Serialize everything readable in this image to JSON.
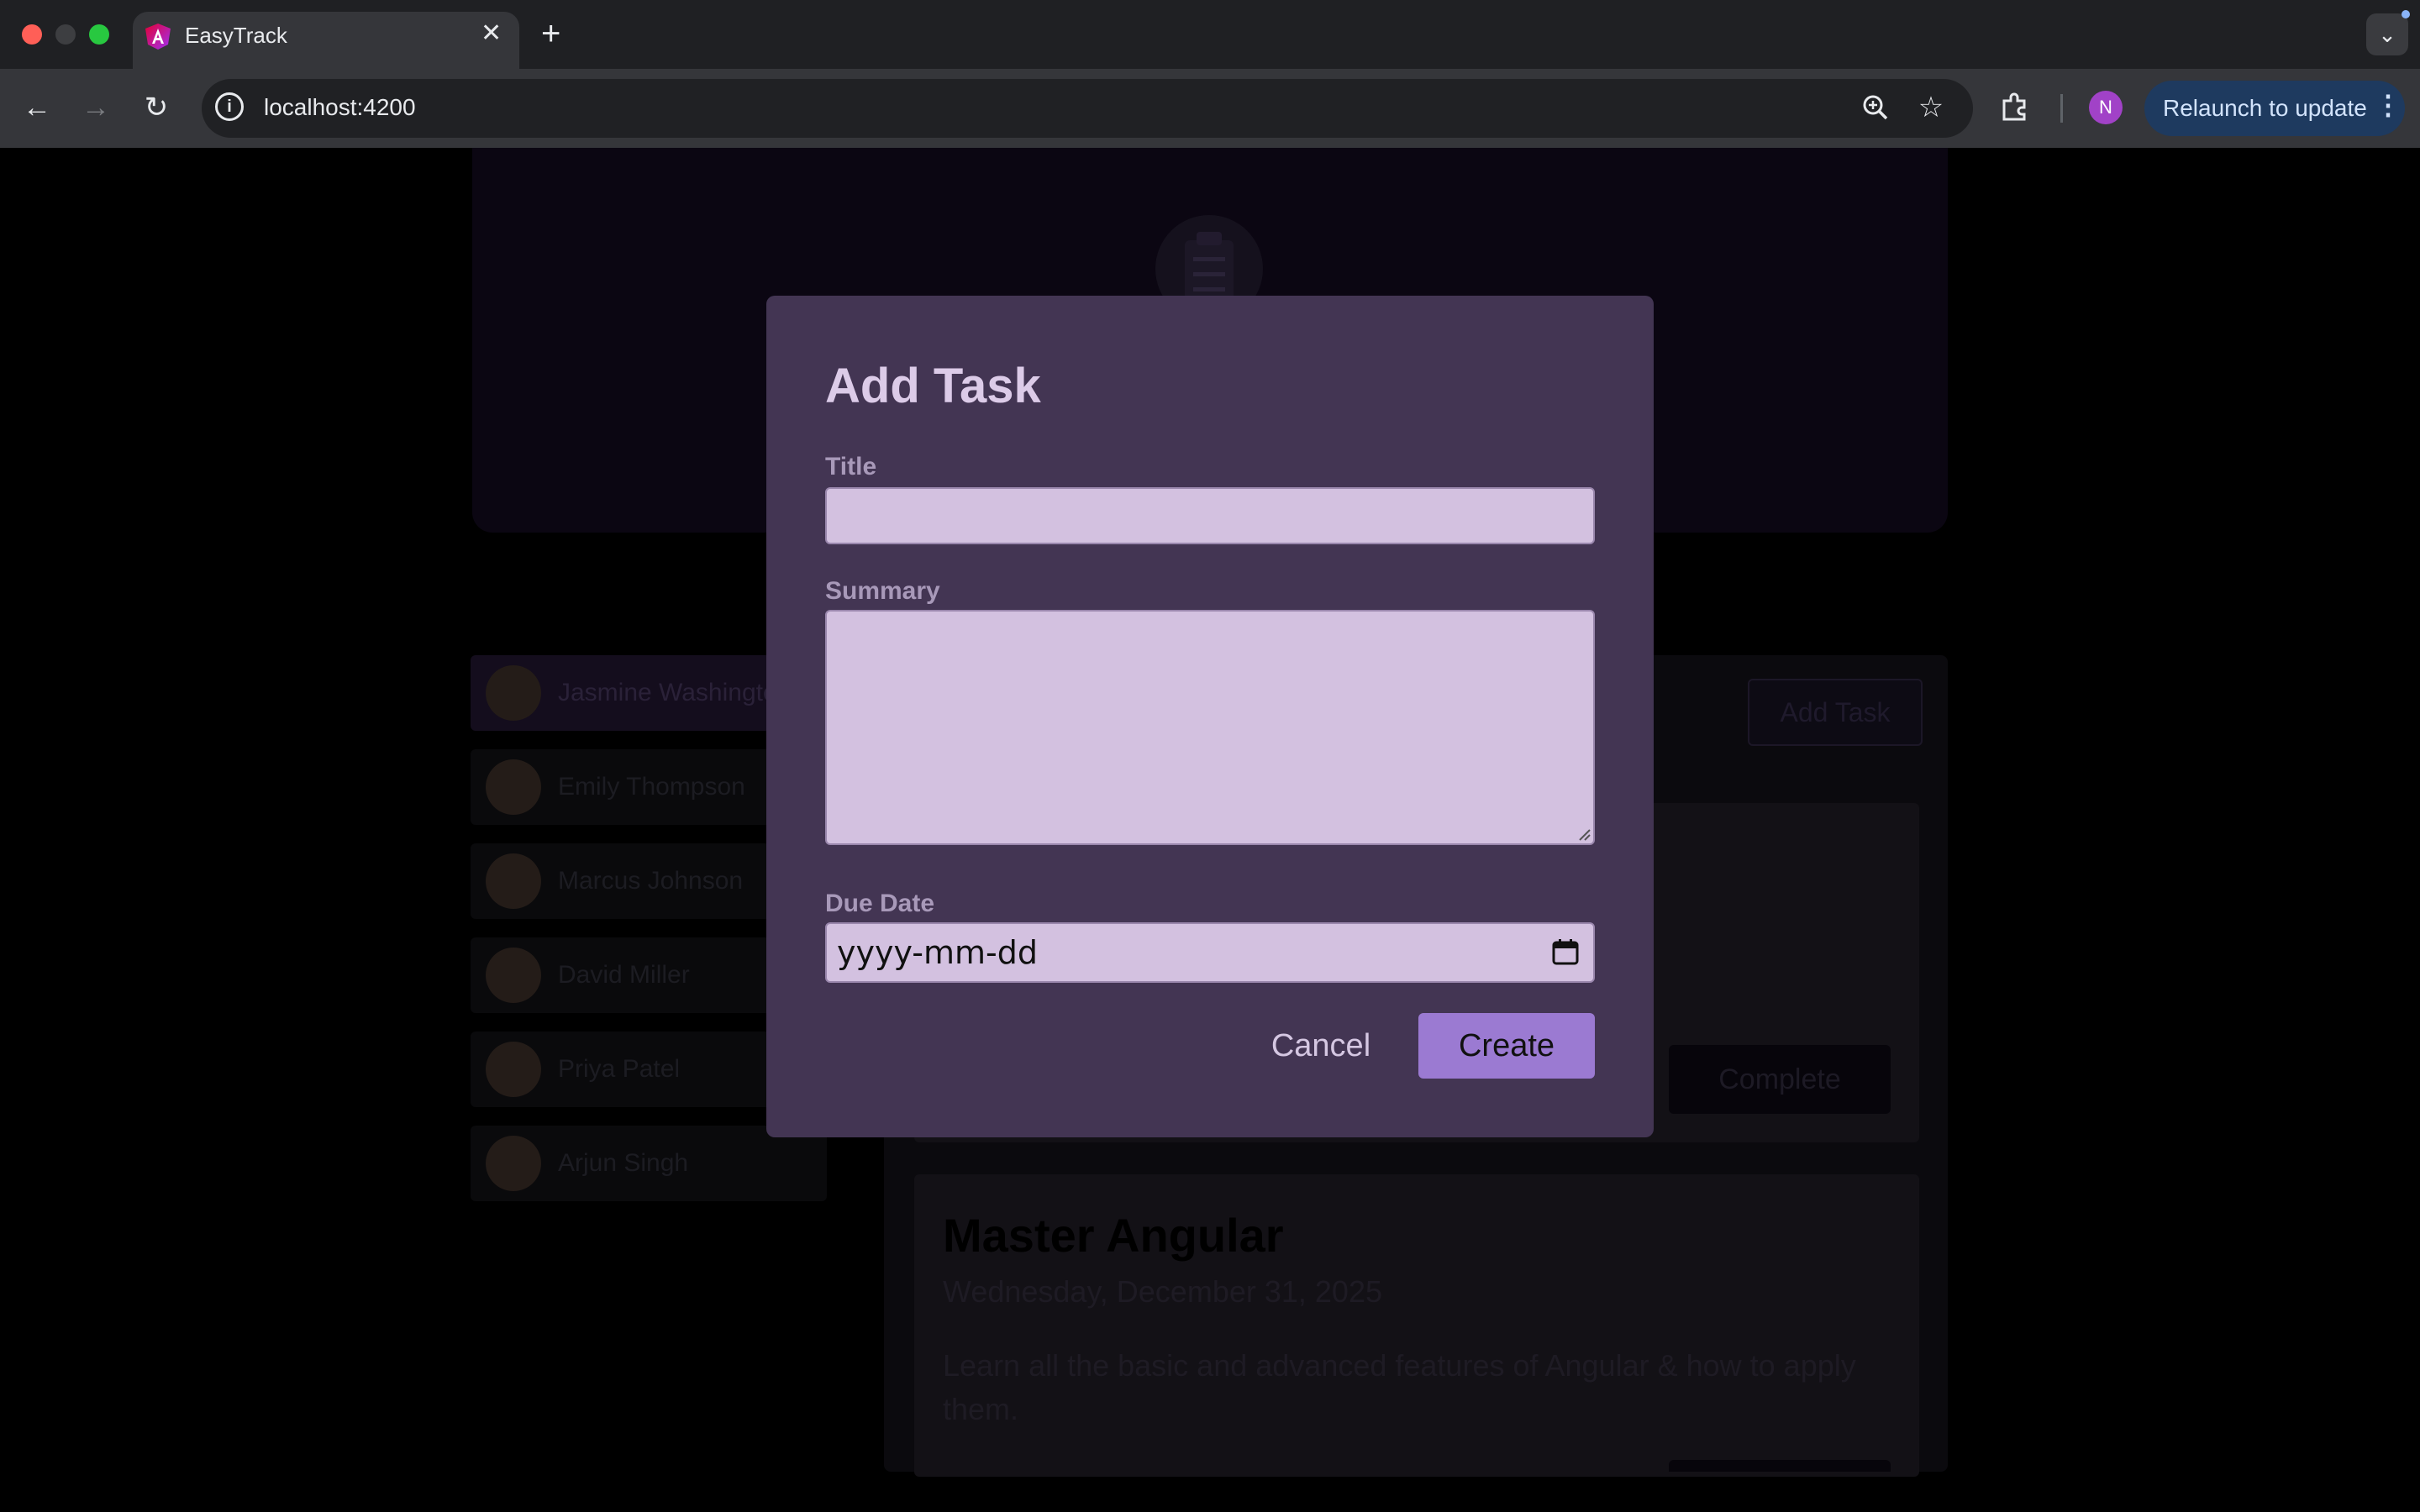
{
  "browser": {
    "tab_title": "EasyTrack",
    "url": "localhost:4200",
    "profile_initial": "N",
    "relaunch_label": "Relaunch to update"
  },
  "page": {
    "users": [
      {
        "name": "Jasmine Washington",
        "selected": true
      },
      {
        "name": "Emily Thompson",
        "selected": false
      },
      {
        "name": "Marcus Johnson",
        "selected": false
      },
      {
        "name": "David Miller",
        "selected": false
      },
      {
        "name": "Priya Patel",
        "selected": false
      },
      {
        "name": "Arjun Singh",
        "selected": false
      }
    ],
    "add_task_label": "Add Task",
    "complete_label": "Complete",
    "task": {
      "title": "Master Angular",
      "due_date": "Wednesday, December 31, 2025",
      "summary": "Learn all the basic and advanced features of Angular & how to apply them."
    }
  },
  "modal": {
    "heading": "Add Task",
    "title_label": "Title",
    "title_value": "",
    "summary_label": "Summary",
    "summary_value": "",
    "due_date_label": "Due Date",
    "due_date_placeholder": "yyyy-mm-dd",
    "cancel_label": "Cancel",
    "create_label": "Create"
  },
  "colors": {
    "modal_bg": "#433553",
    "input_bg": "#d3c1e0",
    "create_button": "#9b7ad2",
    "relaunch_bg": "#1e3a5f"
  }
}
